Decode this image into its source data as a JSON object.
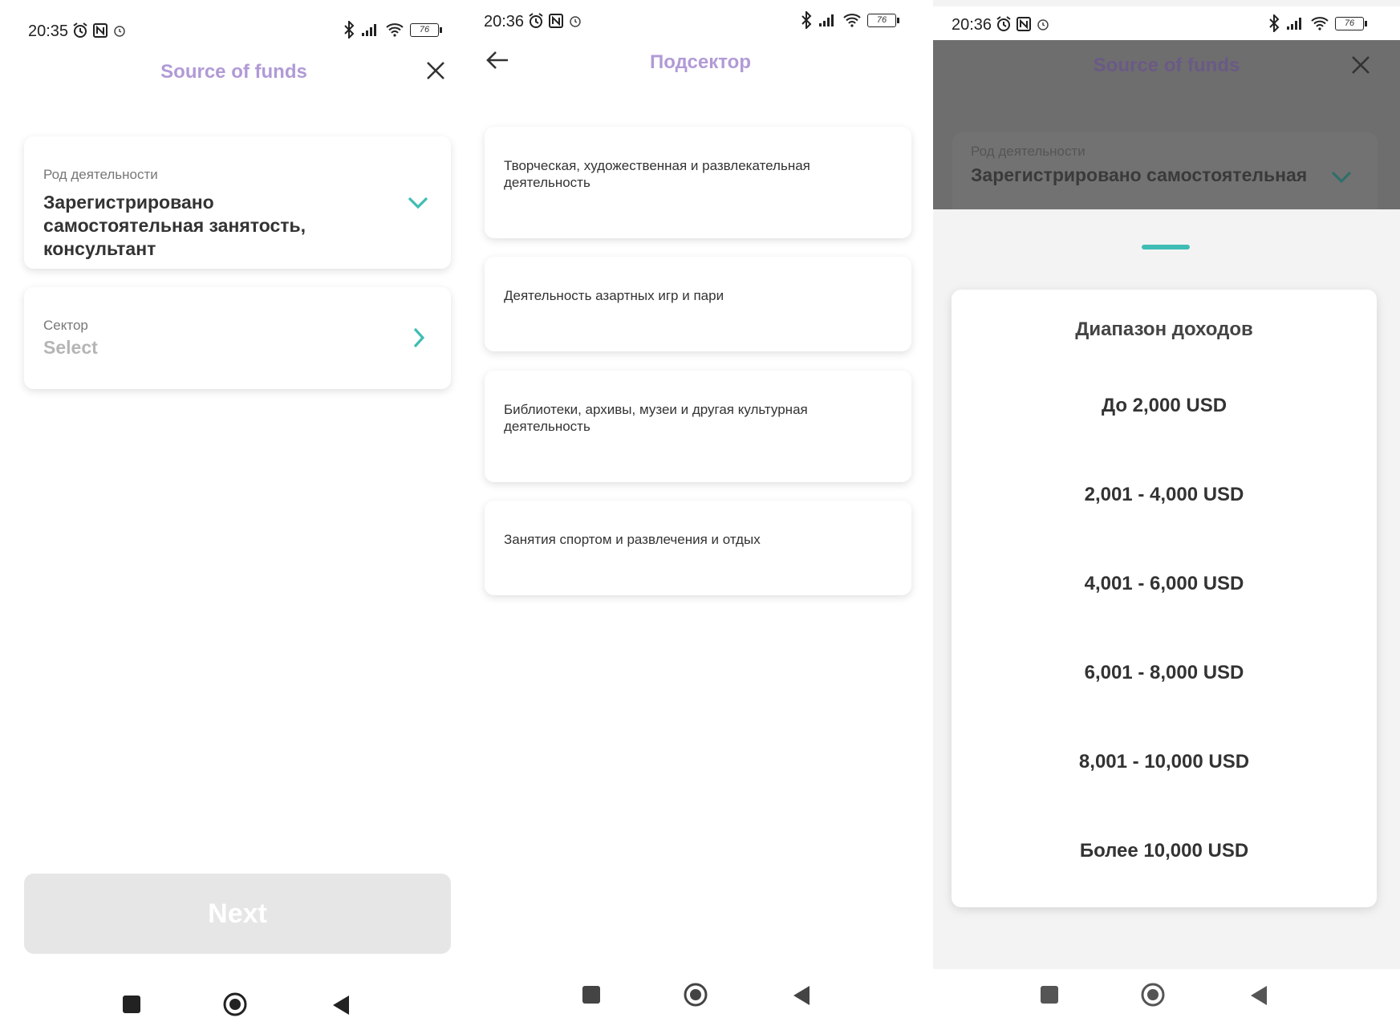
{
  "colors": {
    "accent_teal": "#3fbdb4",
    "title_purple": "#b19ad6",
    "dim_overlay": "#6e6e6e",
    "disabled_button": "#e6e6e6"
  },
  "screen1": {
    "status": {
      "time": "20:35",
      "battery": "76"
    },
    "header": {
      "title": "Source of funds",
      "close_icon": "close-icon"
    },
    "activity": {
      "label": "Род деятельности",
      "value": "Зарегистрировано самостоятельная занятость, консультант",
      "icon": "chevron-down-icon"
    },
    "sector": {
      "label": "Сектор",
      "placeholder": "Select",
      "icon": "chevron-right-icon"
    },
    "next_label": "Next"
  },
  "screen2": {
    "status": {
      "time": "20:36",
      "battery": "76"
    },
    "header": {
      "title": "Подсектор",
      "back_icon": "arrow-left-icon"
    },
    "items": [
      {
        "label": "Творческая, художественная и развлекательная деятельность"
      },
      {
        "label": "Деятельность азартных игр и пари"
      },
      {
        "label": "Библиотеки, архивы, музеи и другая культурная деятельность"
      },
      {
        "label": "Занятия спортом и развлечения и отдых"
      }
    ]
  },
  "screen3": {
    "status": {
      "time": "20:36",
      "battery": "76"
    },
    "background": {
      "title": "Source of funds",
      "activity_label": "Род деятельности",
      "activity_value": "Зарегистрировано самостоятельная"
    },
    "sheet": {
      "title": "Диапазон доходов",
      "options": [
        {
          "label": "До 2,000 USD"
        },
        {
          "label": "2,001 - 4,000 USD"
        },
        {
          "label": "4,001 - 6,000 USD"
        },
        {
          "label": "6,001 - 8,000 USD"
        },
        {
          "label": "8,001 - 10,000 USD"
        },
        {
          "label": "Более 10,000 USD"
        }
      ]
    }
  },
  "navbar": {
    "icons": [
      "square-icon",
      "home-circle-icon",
      "back-triangle-icon"
    ]
  }
}
